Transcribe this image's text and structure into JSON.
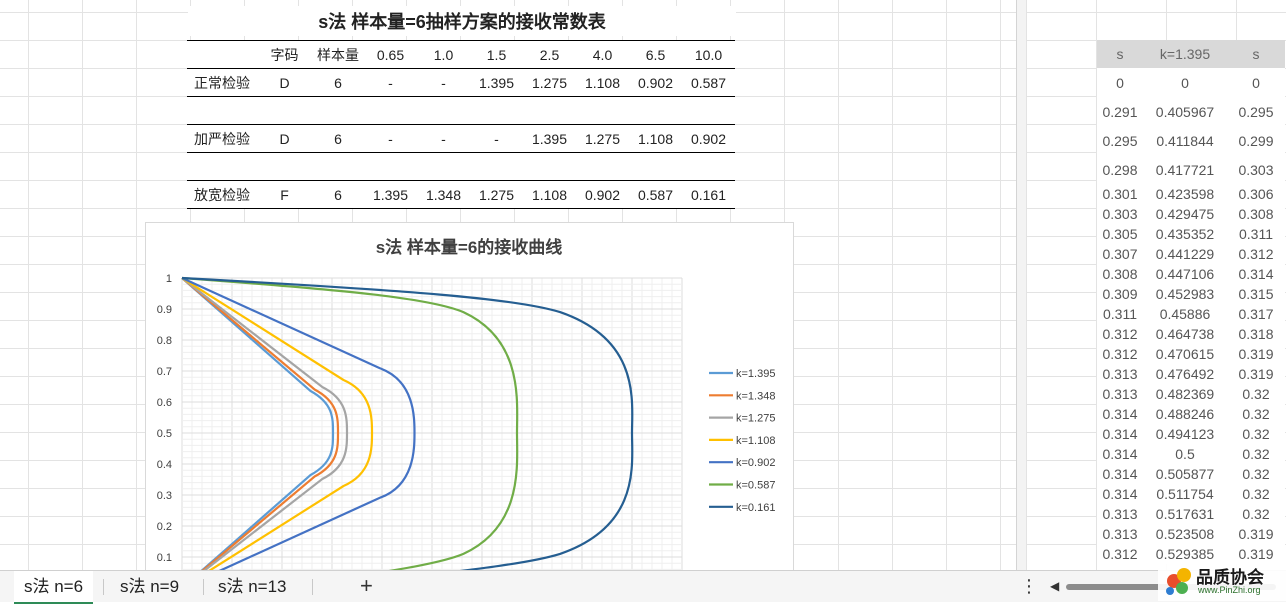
{
  "main": {
    "title": "s法 样本量=6抽样方案的接收常数表",
    "header": [
      "",
      "字码",
      "样本量",
      "0.65",
      "1.0",
      "1.5",
      "2.5",
      "4.0",
      "6.5",
      "10.0"
    ],
    "rows": [
      {
        "label": "正常检验",
        "cells": [
          "D",
          "6",
          "-",
          "-",
          "1.395",
          "1.275",
          "1.108",
          "0.902",
          "0.587"
        ]
      },
      {
        "label": "加严检验",
        "cells": [
          "D",
          "6",
          "-",
          "-",
          "-",
          "1.395",
          "1.275",
          "1.108",
          "0.902"
        ]
      },
      {
        "label": "放宽检验",
        "cells": [
          "F",
          "6",
          "1.395",
          "1.348",
          "1.275",
          "1.108",
          "0.902",
          "0.587",
          "0.161"
        ]
      }
    ]
  },
  "chart_data": {
    "type": "line",
    "title": "s法 样本量=6的接收曲线",
    "yticks": [
      "1",
      "0.9",
      "0.8",
      "0.7",
      "0.6",
      "0.5",
      "0.4",
      "0.3",
      "0.2",
      "0.1"
    ],
    "ylim": [
      0,
      1
    ],
    "legend_position": "right",
    "series": [
      {
        "name": "k=1.395",
        "color": "#5b9bd5",
        "xmax": 0.302
      },
      {
        "name": "k=1.348",
        "color": "#ed7d31",
        "xmax": 0.312
      },
      {
        "name": "k=1.275",
        "color": "#a5a5a5",
        "xmax": 0.33
      },
      {
        "name": "k=1.108",
        "color": "#ffc000",
        "xmax": 0.38
      },
      {
        "name": "k=0.902",
        "color": "#4472c4",
        "xmax": 0.465
      },
      {
        "name": "k=0.587",
        "color": "#70ad47",
        "xmax": 0.67
      },
      {
        "name": "k=0.161",
        "color": "#255e91",
        "xmax": 0.9
      }
    ]
  },
  "side": {
    "header": [
      "s",
      "k=1.395",
      "s"
    ],
    "rows": [
      [
        "0",
        "0",
        "0"
      ],
      [
        "0.291",
        "0.405967",
        "0.295"
      ],
      [
        "0.295",
        "0.411844",
        "0.299"
      ],
      [
        "0.298",
        "0.417721",
        "0.303"
      ],
      [
        "0.301",
        "0.423598",
        "0.306"
      ],
      [
        "0.303",
        "0.429475",
        "0.308"
      ],
      [
        "0.305",
        "0.435352",
        "0.311"
      ],
      [
        "0.307",
        "0.441229",
        "0.312"
      ],
      [
        "0.308",
        "0.447106",
        "0.314"
      ],
      [
        "0.309",
        "0.452983",
        "0.315"
      ],
      [
        "0.311",
        "0.45886",
        "0.317"
      ],
      [
        "0.312",
        "0.464738",
        "0.318"
      ],
      [
        "0.312",
        "0.470615",
        "0.319"
      ],
      [
        "0.313",
        "0.476492",
        "0.319"
      ],
      [
        "0.313",
        "0.482369",
        "0.32"
      ],
      [
        "0.314",
        "0.488246",
        "0.32"
      ],
      [
        "0.314",
        "0.494123",
        "0.32"
      ],
      [
        "0.314",
        "0.5",
        "0.32"
      ],
      [
        "0.314",
        "0.505877",
        "0.32"
      ],
      [
        "0.314",
        "0.511754",
        "0.32"
      ],
      [
        "0.313",
        "0.517631",
        "0.32"
      ],
      [
        "0.313",
        "0.523508",
        "0.319"
      ],
      [
        "0.312",
        "0.529385",
        "0.319"
      ]
    ]
  },
  "tabs": [
    {
      "label": "s法 n=6",
      "active": true
    },
    {
      "label": "s法 n=9",
      "active": false
    },
    {
      "label": "s法 n=13",
      "active": false
    }
  ],
  "tabbar": {
    "add_label": "+",
    "more_label": "⋮",
    "scroll_left": "◀"
  },
  "watermark": {
    "title": "品质协会",
    "url": "www.PinZhi.org"
  }
}
